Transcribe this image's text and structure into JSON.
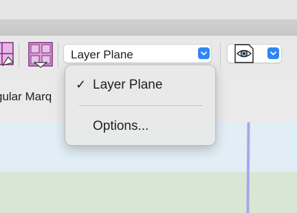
{
  "toolbar": {
    "layer_select_value": "Layer Plane",
    "view_select_icon": "eye-icon",
    "tool_icons": [
      "marquee-corner-icon",
      "grid-split-icon"
    ]
  },
  "options_row": {
    "marquee_label": "gular Marq"
  },
  "dropdown_menu": {
    "items": [
      {
        "label": "Layer Plane",
        "checked": true,
        "check_glyph": "✓"
      },
      {
        "label": "Options...",
        "checked": false
      }
    ]
  },
  "colors": {
    "accent": "#2f86f5",
    "guide": "#a7a6ee",
    "canvas_blue": "#e2eef6",
    "canvas_green": "#d9e6d3",
    "tool_magenta": "#c23fbf"
  }
}
